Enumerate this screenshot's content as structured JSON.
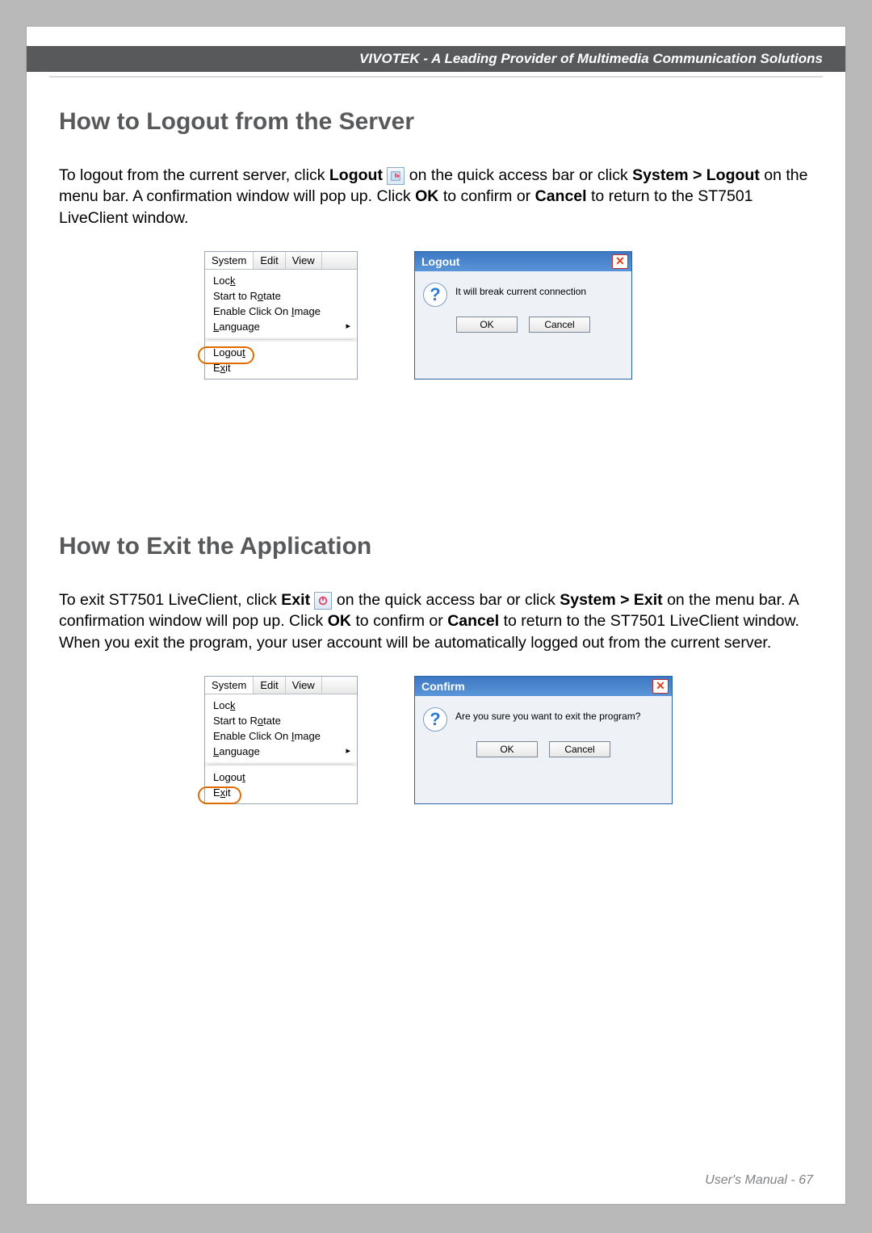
{
  "header": {
    "brand_text": "VIVOTEK - A Leading Provider of Multimedia Communication Solutions"
  },
  "section_logout": {
    "heading": "How to Logout from the Server",
    "para_pre": "To logout from the current server, click ",
    "logout_bold": "Logout",
    "para_mid1": " on the quick access bar or click ",
    "system_path": "System > Logout",
    "para_mid2": " on the menu bar. A confirmation window will pop up. Click ",
    "ok_bold": "OK",
    "para_mid3": " to confirm or ",
    "cancel_bold": "Cancel",
    "para_end": " to return to the ST7501 LiveClient window."
  },
  "system_menu": {
    "tab_system": "System",
    "tab_edit": "Edit",
    "tab_view": "View",
    "item_lock": "Lock",
    "item_rotate": "Start to Rotate",
    "item_clickimage": "Enable Click On Image",
    "item_language": "Language",
    "item_logout": "Logout",
    "item_exit": "Exit"
  },
  "logout_dialog": {
    "title": "Logout",
    "message": "It will break current connection",
    "ok": "OK",
    "cancel": "Cancel"
  },
  "section_exit": {
    "heading": "How to Exit the Application",
    "para_pre": "To exit ST7501 LiveClient, click ",
    "exit_bold": "Exit",
    "para_mid1": " on the quick access bar or click ",
    "system_path": "System > Exit",
    "para_mid2": " on the menu bar. A confirmation window will pop up. Click ",
    "ok_bold": "OK",
    "para_mid3": " to confirm or ",
    "cancel_bold": "Cancel",
    "para_end": " to return to the ST7501 LiveClient window. When you exit the program, your user account will be automatically logged out from the current server."
  },
  "confirm_dialog": {
    "title": "Confirm",
    "message": "Are you sure you want to exit the program?",
    "ok": "OK",
    "cancel": "Cancel"
  },
  "footer": {
    "label": "User's Manual - ",
    "page": "67"
  }
}
